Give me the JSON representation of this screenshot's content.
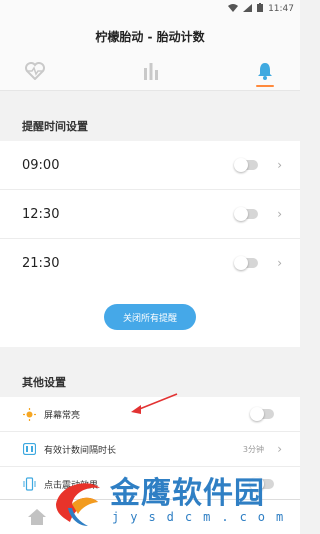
{
  "status_bar": {
    "time": "11:47"
  },
  "header": {
    "title": "柠檬胎动 - 胎动计数"
  },
  "tabs": [
    {
      "icon": "heart-pulse-icon"
    },
    {
      "icon": "bar-chart-icon"
    },
    {
      "icon": "bell-icon",
      "active": true
    }
  ],
  "reminder_section": {
    "title": "提醒时间设置",
    "items": [
      {
        "time": "09:00",
        "enabled": false
      },
      {
        "time": "12:30",
        "enabled": false
      },
      {
        "time": "21:30",
        "enabled": false
      }
    ],
    "close_all_label": "关闭所有提醒"
  },
  "other_section": {
    "title": "其他设置",
    "items": [
      {
        "label": "屏幕常亮",
        "icon": "sun-icon",
        "enabled": false
      },
      {
        "label": "有效计数间隔时长",
        "icon": "timer-icon",
        "value": "3分钟"
      },
      {
        "label": "点击震动效果",
        "icon": "vibrate-icon",
        "enabled": false
      }
    ]
  },
  "watermark": {
    "main": "金鹰软件园",
    "sub": "jysdcm.com"
  },
  "colors": {
    "accent": "#ff8a3d",
    "button": "#45a8e8",
    "icon_orange": "#f5a623",
    "icon_blue": "#3fa9e0"
  }
}
